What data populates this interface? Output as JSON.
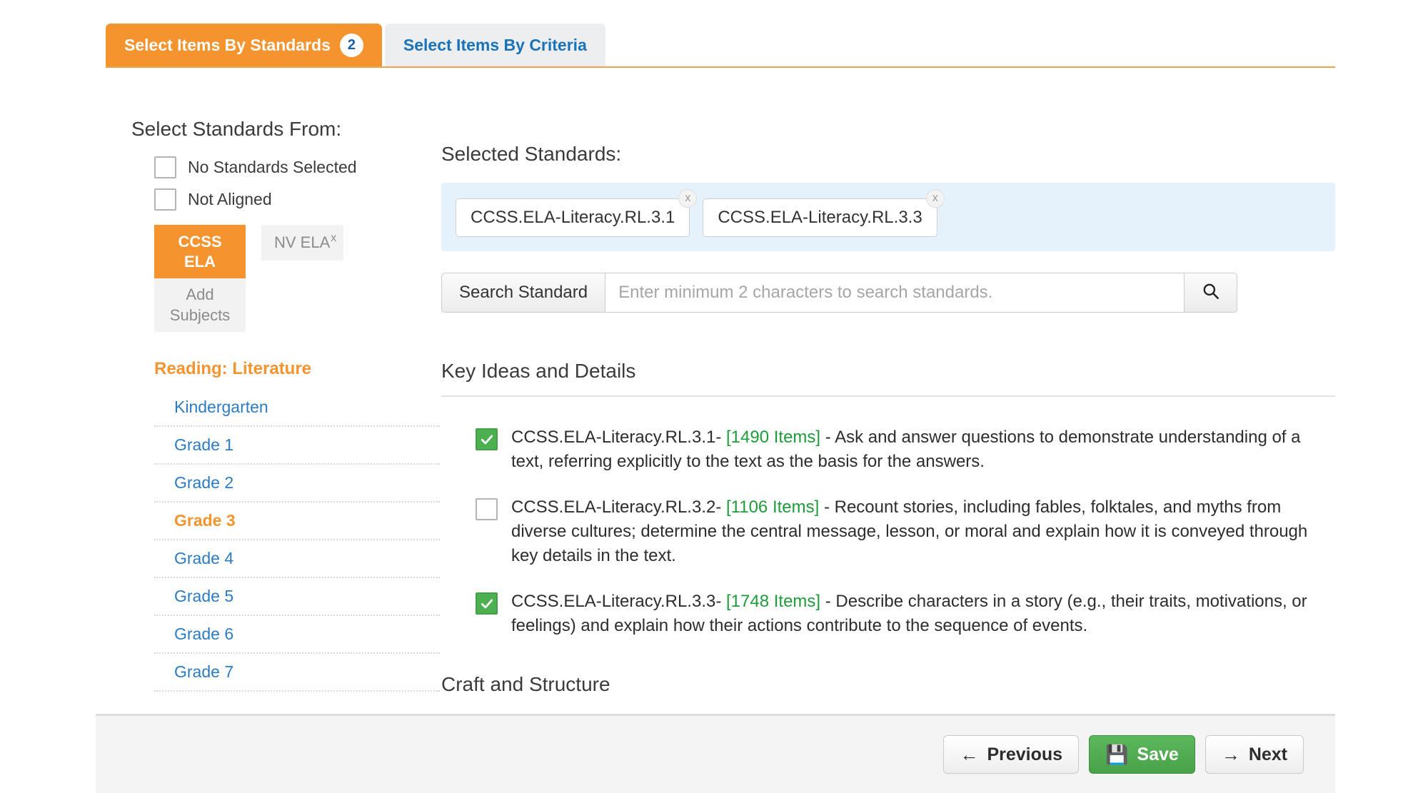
{
  "tabs": [
    {
      "label": "Select Items By Standards",
      "badge": "2",
      "active": true
    },
    {
      "label": "Select Items By Criteria",
      "badge": "",
      "active": false
    }
  ],
  "sidebar": {
    "title": "Select Standards From:",
    "checkboxes": [
      {
        "label": "No Standards Selected",
        "checked": false
      },
      {
        "label": "Not Aligned",
        "checked": false
      }
    ],
    "subjects": {
      "active": "CCSS ELA",
      "active_line1": "CCSS",
      "active_line2": "ELA",
      "other": "NV ELA",
      "other_remove": "x",
      "add_line1": "Add",
      "add_line2": "Subjects"
    },
    "domain": "Reading: Literature",
    "grades": [
      {
        "label": "Kindergarten",
        "current": false
      },
      {
        "label": "Grade 1",
        "current": false
      },
      {
        "label": "Grade 2",
        "current": false
      },
      {
        "label": "Grade 3",
        "current": true
      },
      {
        "label": "Grade 4",
        "current": false
      },
      {
        "label": "Grade 5",
        "current": false
      },
      {
        "label": "Grade 6",
        "current": false
      },
      {
        "label": "Grade 7",
        "current": false
      }
    ]
  },
  "main": {
    "selected_title": "Selected Standards:",
    "selected_chips": [
      {
        "label": "CCSS.ELA-Literacy.RL.3.1",
        "remove": "x"
      },
      {
        "label": "CCSS.ELA-Literacy.RL.3.3",
        "remove": "x"
      }
    ],
    "search": {
      "label": "Search Standard",
      "placeholder": "Enter minimum 2 characters to search standards.",
      "value": "",
      "button_icon": "search-icon"
    },
    "section_1": "Key Ideas and Details",
    "section_2": "Craft and Structure",
    "standards": [
      {
        "checked": true,
        "code": "CCSS.ELA-Literacy.RL.3.1-",
        "items": "[1490 Items]",
        "description": "- Ask and answer questions to demonstrate understanding of a text, referring explicitly to the text as the basis for the answers."
      },
      {
        "checked": false,
        "code": "CCSS.ELA-Literacy.RL.3.2-",
        "items": "[1106 Items]",
        "description": "- Recount stories, including fables, folktales, and myths from diverse cultures; determine the central message, lesson, or moral and explain how it is conveyed through key details in the text."
      },
      {
        "checked": true,
        "code": "CCSS.ELA-Literacy.RL.3.3-",
        "items": "[1748 Items]",
        "description": "- Describe characters in a story (e.g., their traits, motivations, or feelings) and explain how their actions contribute to the sequence of events."
      }
    ]
  },
  "footer": {
    "previous": "Previous",
    "previous_icon": "arrow-left-icon",
    "save": "Save",
    "save_icon": "floppy-disk-icon",
    "next": "Next",
    "next_icon": "arrow-right-icon"
  },
  "colors": {
    "accent_orange": "#f5942e",
    "link_blue": "#2b7cc4",
    "checked_green": "#4caf50",
    "items_green": "#1f9c3a",
    "chips_bg": "#e6f2fb"
  }
}
